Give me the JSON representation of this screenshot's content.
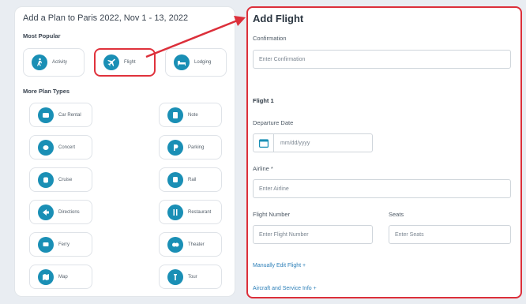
{
  "left": {
    "title": "Add a Plan to Paris 2022, Nov 1 - 13, 2022",
    "most_popular_label": "Most Popular",
    "popular": [
      {
        "label": "Activity",
        "icon": "activity-icon"
      },
      {
        "label": "Flight",
        "icon": "plane-icon"
      },
      {
        "label": "Lodging",
        "icon": "bed-icon"
      }
    ],
    "more_label": "More Plan Types",
    "more": [
      {
        "label": "Car Rental",
        "icon": "car-icon"
      },
      {
        "label": "Note",
        "icon": "note-icon"
      },
      {
        "label": "Concert",
        "icon": "concert-icon"
      },
      {
        "label": "Parking",
        "icon": "parking-icon"
      },
      {
        "label": "Cruise",
        "icon": "cruise-icon"
      },
      {
        "label": "Rail",
        "icon": "rail-icon"
      },
      {
        "label": "Directions",
        "icon": "directions-icon"
      },
      {
        "label": "Restaurant",
        "icon": "restaurant-icon"
      },
      {
        "label": "Ferry",
        "icon": "ferry-icon"
      },
      {
        "label": "Theater",
        "icon": "theater-icon"
      },
      {
        "label": "Map",
        "icon": "map-icon"
      },
      {
        "label": "Tour",
        "icon": "tour-icon"
      }
    ]
  },
  "form": {
    "title": "Add Flight",
    "confirmation_label": "Confirmation",
    "confirmation_placeholder": "Enter Confirmation",
    "section": "Flight 1",
    "departure_label": "Departure Date",
    "date_placeholder": "mm/dd/yyyy",
    "airline_label": "Airline *",
    "airline_placeholder": "Enter Airline",
    "flight_number_label": "Flight Number",
    "flight_number_placeholder": "Enter Flight Number",
    "seats_label": "Seats",
    "seats_placeholder": "Enter Seats",
    "manual_link": "Manually Edit Flight +",
    "aircraft_link": "Aircraft and Service Info +"
  },
  "colors": {
    "accent": "#1a8fb5",
    "highlight": "#dc2f3a",
    "link": "#2c7fb8"
  }
}
